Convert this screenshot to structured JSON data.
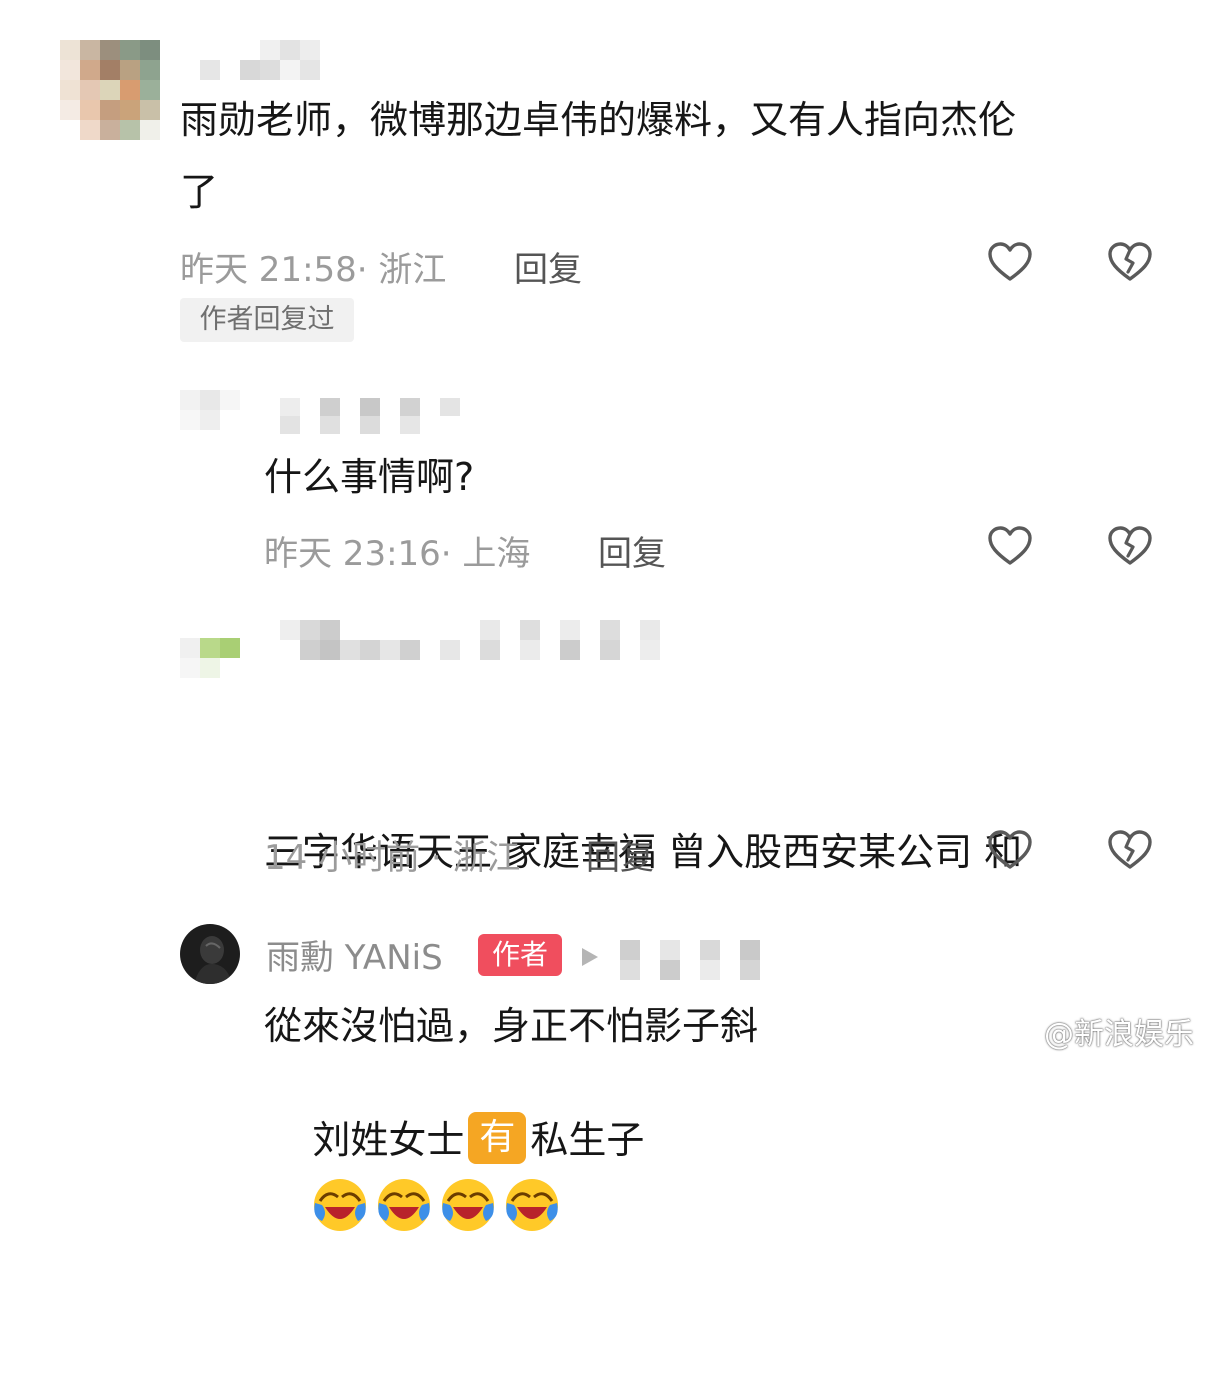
{
  "comments": [
    {
      "text": "雨勋老师，微博那边卓伟的爆料，又有人指向杰伦\n了",
      "time_location": "昨天 21:58· 浙江",
      "reply_label": "回复",
      "tag": "作者回复过"
    },
    {
      "text": "什么事情啊?",
      "time_location": "昨天 23:16· 上海",
      "reply_label": "回复"
    },
    {
      "text_line1": "三字华语天王 家庭幸福 曾入股西安某公司 和",
      "text_line2_prefix": "刘姓女士",
      "text_line2_badge": "有",
      "text_line2_suffix": "私生子",
      "time_location": "14 小时前 · 浙江",
      "reply_label": "回复"
    },
    {
      "author_name": "雨勳 YANiS",
      "author_badge": "作者",
      "text": "從來沒怕過，身正不怕影子斜"
    }
  ],
  "watermark": "@新浪娱乐",
  "icons": {
    "like": "heart-outline-icon",
    "dislike": "broken-heart-icon",
    "crying_emoji": "crying-laughing-emoji",
    "reply_arrow": "play-triangle-icon",
    "weibo_logo": "weibo-logo-icon"
  },
  "colors": {
    "author_badge": "#f04e5e",
    "highlight_badge": "#f5a623",
    "meta_text": "#9b9b9b",
    "icon_stroke": "#5a5a5a"
  }
}
